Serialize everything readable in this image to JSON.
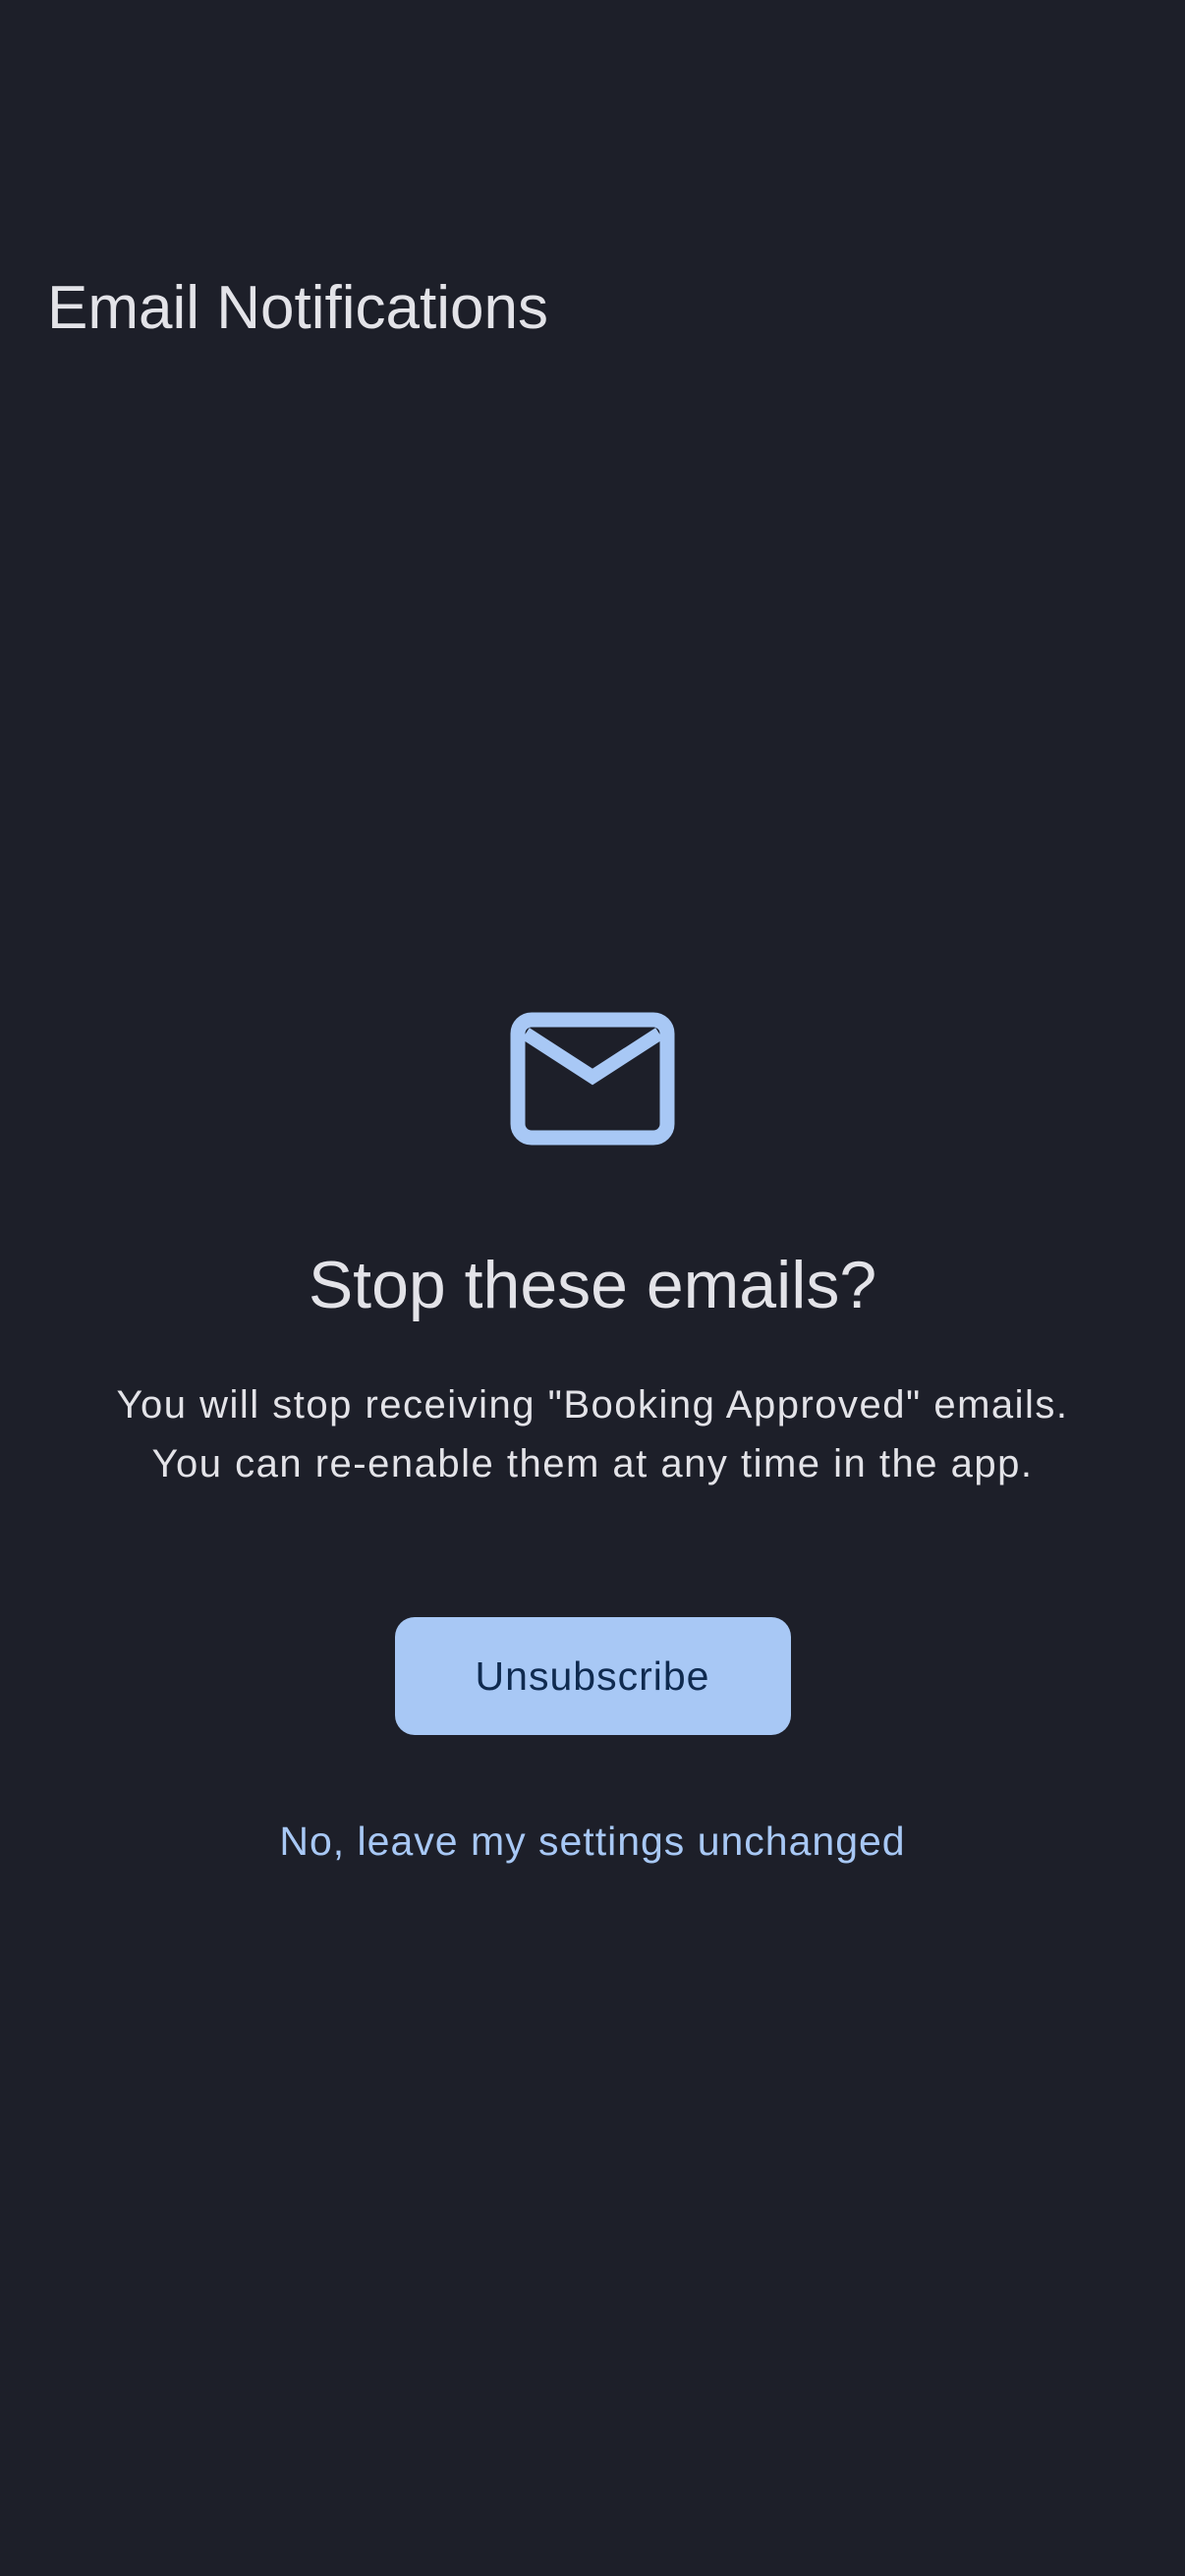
{
  "app_bar": {
    "title": "Email Notifications"
  },
  "dialog": {
    "icon": "mail-icon",
    "title": "Stop these emails?",
    "body": "You will stop receiving \"Booking Approved\" emails. You can re-enable them at any time in the app.",
    "primary_action_label": "Unsubscribe",
    "secondary_action_label": "No, leave my settings unchanged"
  },
  "colors": {
    "background": "#1d1f29",
    "text": "#e3e3e8",
    "accent": "#a8c8f5",
    "button_text": "#0f2a4f"
  }
}
